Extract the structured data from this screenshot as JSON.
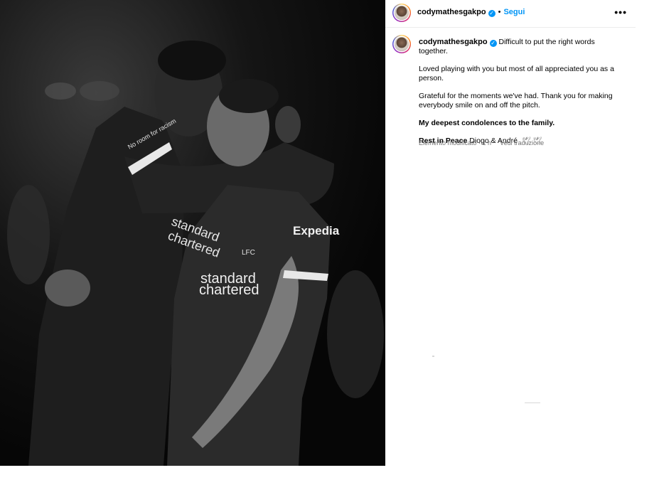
{
  "post": {
    "photo_alt": "",
    "header": {
      "username": "codymathesgakpo",
      "separator": "•",
      "follow_label": "Segui",
      "more_label": "•••"
    },
    "caption": {
      "username": "codymathesgakpo",
      "line1": "Difficult to put the right words together.",
      "paragraph2": "Loved playing with you but most of all appreciated you as a person.",
      "paragraph3": "Grateful for the moments we've had. Thank you for making everybody smile on and off the pitch.",
      "paragraph4": "My deepest condolences to the family.",
      "rip_bold": "Rest in Peace",
      "rip_rest": "Diogo & André",
      "doves": "🕊 🕊"
    },
    "meta": {
      "edited": "Elemento modificato",
      "time": "1 h",
      "translate": "Vedi traduzione"
    },
    "photo_text": {
      "sponsor_line1": "standard",
      "sponsor_line2": "chartered",
      "sponsor2_line1": "standard",
      "sponsor2_line2": "chartered",
      "expedia": "Expedia",
      "club": "LFC",
      "sleeve": "No room for racism"
    }
  },
  "colors": {
    "link": "#0095f6",
    "verified": "#0095f6",
    "muted": "#737373"
  }
}
